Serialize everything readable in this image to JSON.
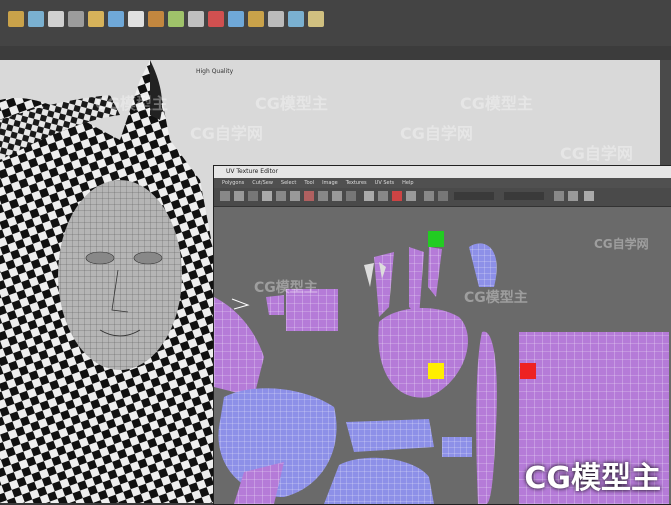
{
  "app": {
    "viewport_label": "High Quality"
  },
  "uv_editor": {
    "title": "UV Texture Editor",
    "menus": [
      "Polygons",
      "Cut/Sew",
      "Select",
      "Tool",
      "Image",
      "Textures",
      "UV Sets",
      "Help"
    ]
  },
  "watermark": {
    "text": "CG模型主",
    "site_text": "CG自学网",
    "bottom_text": "CG模型主"
  },
  "colors": {
    "accent_green": "#22cc22",
    "accent_yellow": "#ffee00",
    "accent_red": "#ee2222",
    "uv_purple": "#b47ad8",
    "uv_blue": "#8b8ee8"
  }
}
